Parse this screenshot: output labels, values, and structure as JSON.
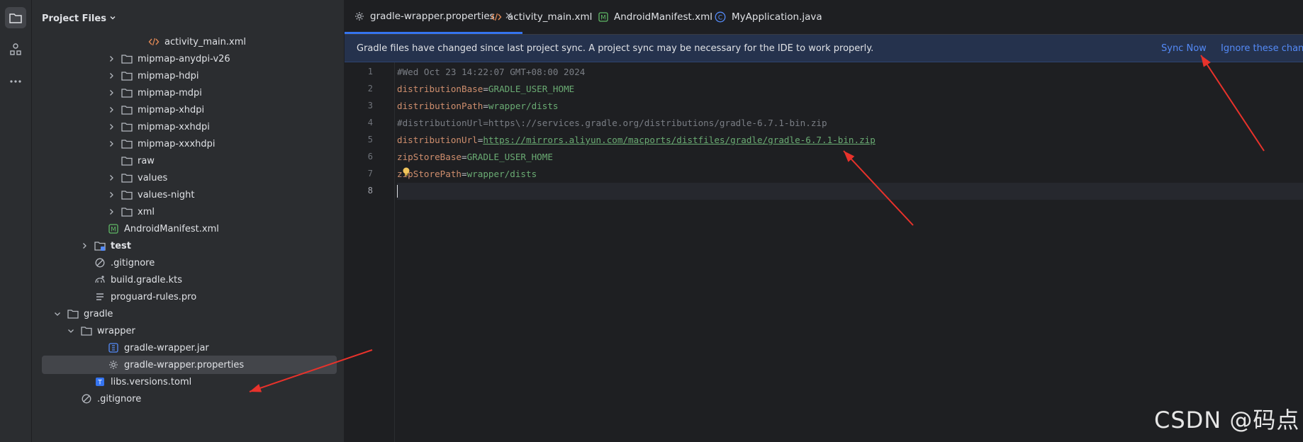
{
  "project_panel": {
    "title": "Project Files",
    "tree": [
      {
        "label": "activity_main.xml",
        "icon": "xml-file-icon",
        "expandable": false,
        "bold": false
      },
      {
        "label": "mipmap-anydpi-v26",
        "icon": "folder-icon",
        "expandable": true,
        "bold": false
      },
      {
        "label": "mipmap-hdpi",
        "icon": "folder-icon",
        "expandable": true,
        "bold": false
      },
      {
        "label": "mipmap-mdpi",
        "icon": "folder-icon",
        "expandable": true,
        "bold": false
      },
      {
        "label": "mipmap-xhdpi",
        "icon": "folder-icon",
        "expandable": true,
        "bold": false
      },
      {
        "label": "mipmap-xxhdpi",
        "icon": "folder-icon",
        "expandable": true,
        "bold": false
      },
      {
        "label": "mipmap-xxxhdpi",
        "icon": "folder-icon",
        "expandable": true,
        "bold": false
      },
      {
        "label": "raw",
        "icon": "folder-icon",
        "expandable": false,
        "bold": false
      },
      {
        "label": "values",
        "icon": "folder-icon",
        "expandable": true,
        "bold": false
      },
      {
        "label": "values-night",
        "icon": "folder-icon",
        "expandable": true,
        "bold": false
      },
      {
        "label": "xml",
        "icon": "folder-icon",
        "expandable": true,
        "bold": false
      },
      {
        "label": "AndroidManifest.xml",
        "icon": "manifest-file-icon",
        "expandable": false,
        "bold": false
      },
      {
        "label": "test",
        "icon": "test-folder-icon",
        "expandable": true,
        "bold": true
      },
      {
        "label": ".gitignore",
        "icon": "gitignore-icon",
        "expandable": false,
        "bold": false
      },
      {
        "label": "build.gradle.kts",
        "icon": "gradle-file-icon",
        "expandable": false,
        "bold": false
      },
      {
        "label": "proguard-rules.pro",
        "icon": "text-file-icon",
        "expandable": false,
        "bold": false
      },
      {
        "label": "gradle",
        "icon": "folder-icon",
        "expandable": true,
        "expanded": true,
        "bold": false
      },
      {
        "label": "wrapper",
        "icon": "folder-icon",
        "expandable": true,
        "expanded": true,
        "bold": false
      },
      {
        "label": "gradle-wrapper.jar",
        "icon": "jar-file-icon",
        "expandable": false,
        "bold": false
      },
      {
        "label": "gradle-wrapper.properties",
        "icon": "properties-file-icon",
        "expandable": false,
        "bold": false,
        "selected": true
      },
      {
        "label": "libs.versions.toml",
        "icon": "toml-file-icon",
        "expandable": false,
        "bold": false
      },
      {
        "label": ".gitignore",
        "icon": "gitignore-icon",
        "expandable": false,
        "bold": false
      }
    ]
  },
  "tabs": [
    {
      "label": "gradle-wrapper.properties",
      "icon": "properties-file-icon",
      "active": true,
      "closable": true
    },
    {
      "label": "activity_main.xml",
      "icon": "xml-file-icon",
      "active": false
    },
    {
      "label": "AndroidManifest.xml",
      "icon": "manifest-file-icon",
      "active": false
    },
    {
      "label": "MyApplication.java",
      "icon": "java-class-icon",
      "active": false
    }
  ],
  "notification": {
    "message": "Gradle files have changed since last project sync. A project sync may be necessary for the IDE to work properly.",
    "sync_now": "Sync Now",
    "ignore": "Ignore these chang"
  },
  "code_lines": [
    {
      "n": "1",
      "kind": "comment",
      "text": "#Wed Oct 23 14:22:07 GMT+08:00 2024"
    },
    {
      "n": "2",
      "kind": "kv",
      "key": "distributionBase",
      "value": "GRADLE_USER_HOME"
    },
    {
      "n": "3",
      "kind": "kv",
      "key": "distributionPath",
      "value": "wrapper/dists"
    },
    {
      "n": "4",
      "kind": "comment",
      "text": "#distributionUrl=https\\://services.gradle.org/distributions/gradle-6.7.1-bin.zip"
    },
    {
      "n": "5",
      "kind": "url",
      "key": "distributionUrl",
      "value": "https://mirrors.aliyun.com/macports/distfiles/gradle/gradle-6.7.1-bin.zip"
    },
    {
      "n": "6",
      "kind": "kv",
      "key": "zipStoreBase",
      "value": "GRADLE_USER_HOME"
    },
    {
      "n": "7",
      "kind": "kv",
      "key": "zipStorePath",
      "value": "wrapper/dists"
    },
    {
      "n": "8",
      "kind": "empty",
      "text": ""
    }
  ],
  "watermark": "CSDN @码点",
  "annotation_color": "#e8322b"
}
